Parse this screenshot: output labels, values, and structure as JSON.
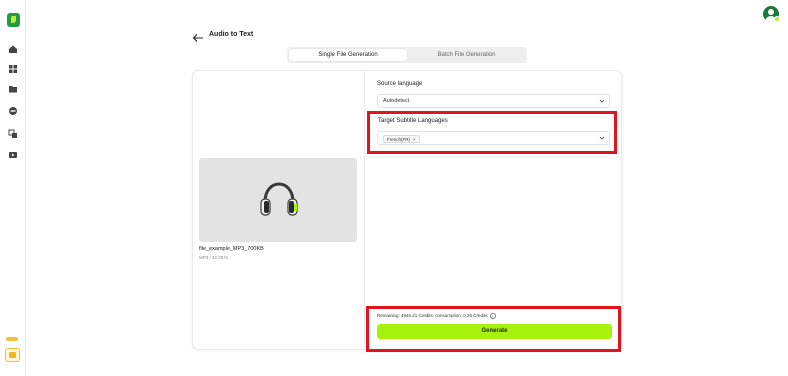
{
  "header": {
    "title": "Audio to Text"
  },
  "tabs": [
    {
      "label": "Single File Generation",
      "active": true
    },
    {
      "label": "Batch File Generation",
      "active": false
    }
  ],
  "file": {
    "name": "file_example_MP3_700KB",
    "meta": "MP3 / 42.057s"
  },
  "source_language": {
    "label": "Source language",
    "value": "Autodetect"
  },
  "target_languages": {
    "label": "Target Subtitle Languages",
    "tags": [
      "French(FR)"
    ],
    "tag_remove": "×"
  },
  "credits": {
    "text": "Remaining: 4945.21 Credits; consumption: 0.25 Credits",
    "info": "i"
  },
  "generate_label": "Generate",
  "sidebar": {
    "items": [
      "home-icon",
      "grid-icon",
      "folder-icon",
      "disc-icon",
      "translate-icon",
      "video-icon"
    ]
  },
  "colors": {
    "accent": "#a6f20c",
    "highlight": "#e0141c",
    "brand": "#1f9d3f"
  }
}
